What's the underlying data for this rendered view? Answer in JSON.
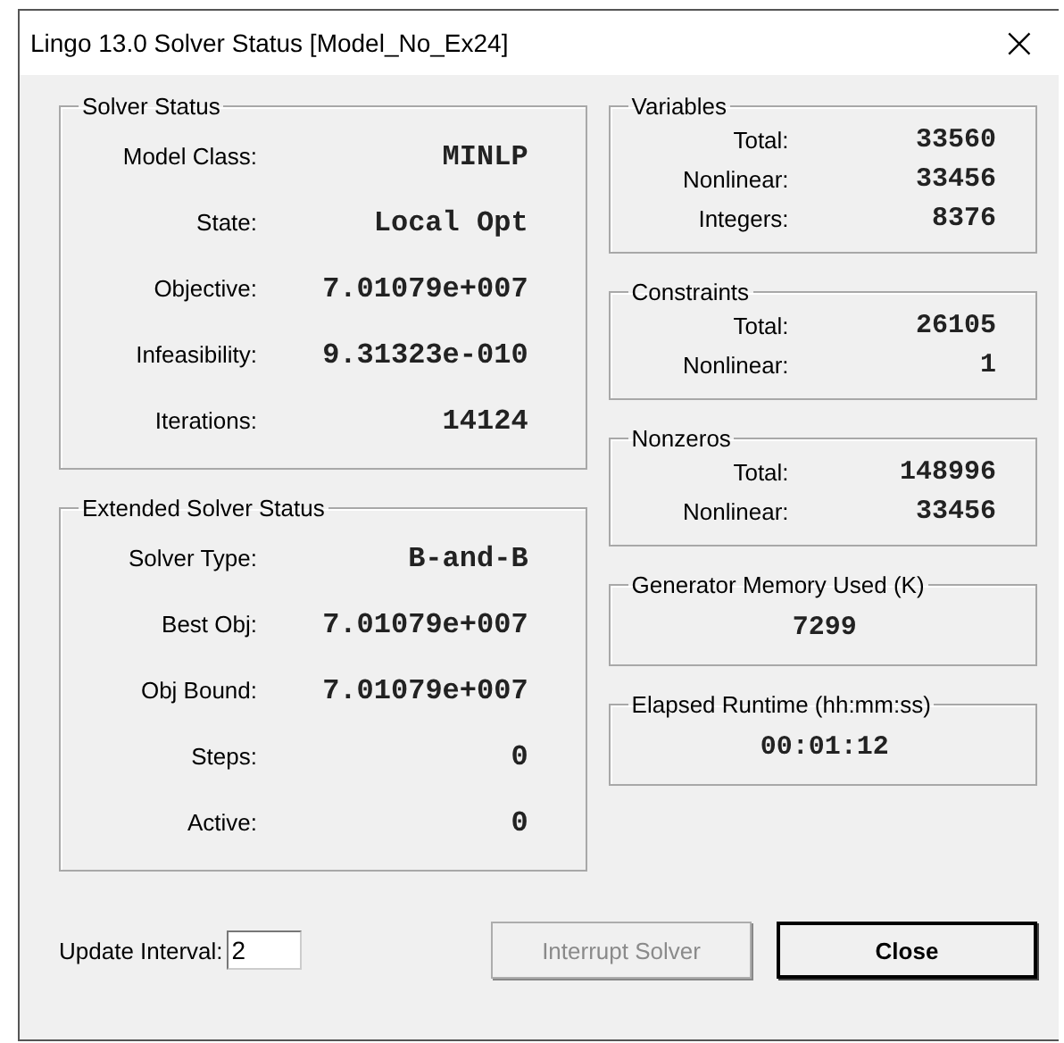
{
  "window": {
    "title": "Lingo 13.0 Solver Status [Model_No_Ex24]",
    "close": "×"
  },
  "left_groups": [
    {
      "title": "Solver Status",
      "rows": [
        {
          "label": "Model Class:",
          "value": "MINLP"
        },
        {
          "label": "State:",
          "value": "Local Opt"
        },
        {
          "label": "Objective:",
          "value": "7.01079e+007"
        },
        {
          "label": "Infeasibility:",
          "value": "9.31323e-010"
        },
        {
          "label": "Iterations:",
          "value": "14124"
        }
      ]
    },
    {
      "title": "Extended Solver Status",
      "rows": [
        {
          "label": "Solver Type:",
          "value": "B-and-B"
        },
        {
          "label": "Best Obj:",
          "value": "7.01079e+007"
        },
        {
          "label": "Obj Bound:",
          "value": "7.01079e+007"
        },
        {
          "label": "Steps:",
          "value": "0"
        },
        {
          "label": "Active:",
          "value": "0"
        }
      ]
    }
  ],
  "right_groups": [
    {
      "title": "Variables",
      "kind": "table",
      "rows": [
        {
          "label": "Total:",
          "value": "33560"
        },
        {
          "label": "Nonlinear:",
          "value": "33456"
        },
        {
          "label": "Integers:",
          "value": "8376"
        }
      ]
    },
    {
      "title": "Constraints",
      "kind": "table",
      "rows": [
        {
          "label": "Total:",
          "value": "26105"
        },
        {
          "label": "Nonlinear:",
          "value": "1"
        }
      ]
    },
    {
      "title": "Nonzeros",
      "kind": "table",
      "rows": [
        {
          "label": "Total:",
          "value": "148996"
        },
        {
          "label": "Nonlinear:",
          "value": "33456"
        }
      ]
    },
    {
      "title": "Generator Memory Used (K)",
      "kind": "single",
      "value": "7299"
    },
    {
      "title": "Elapsed Runtime (hh:mm:ss)",
      "kind": "single",
      "value": "00:01:12"
    }
  ],
  "update_interval": {
    "label": "Update Interval:",
    "value": "2"
  },
  "buttons": [
    {
      "label": "Interrupt Solver",
      "disabled": true
    },
    {
      "label": "Close",
      "disabled": false
    }
  ]
}
